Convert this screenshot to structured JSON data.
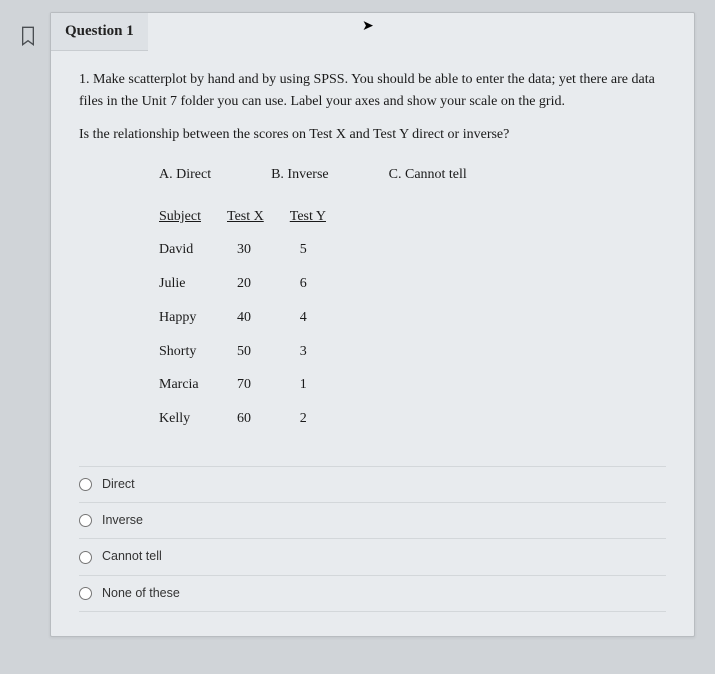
{
  "header": {
    "title": "Question 1"
  },
  "prompt": {
    "line1": "1. Make scatterplot by hand and by using SPSS. You should be able to enter the data; yet there are data files in the Unit 7 folder you can use. Label your axes and show your scale on the grid.",
    "line2": "Is the relationship between the scores on Test X and Test Y direct or inverse?"
  },
  "choices": {
    "a": "A. Direct",
    "b": "B. Inverse",
    "c": "C. Cannot tell"
  },
  "table": {
    "headers": {
      "subject": "Subject",
      "testx": "Test X",
      "testy": "Test Y"
    },
    "rows": [
      {
        "subject": "David",
        "testx": "30",
        "testy": "5"
      },
      {
        "subject": "Julie",
        "testx": "20",
        "testy": "6"
      },
      {
        "subject": "Happy",
        "testx": "40",
        "testy": "4"
      },
      {
        "subject": "Shorty",
        "testx": "50",
        "testy": "3"
      },
      {
        "subject": "Marcia",
        "testx": "70",
        "testy": "1"
      },
      {
        "subject": "Kelly",
        "testx": "60",
        "testy": "2"
      }
    ]
  },
  "answers": [
    "Direct",
    "Inverse",
    "Cannot tell",
    "None of these"
  ]
}
